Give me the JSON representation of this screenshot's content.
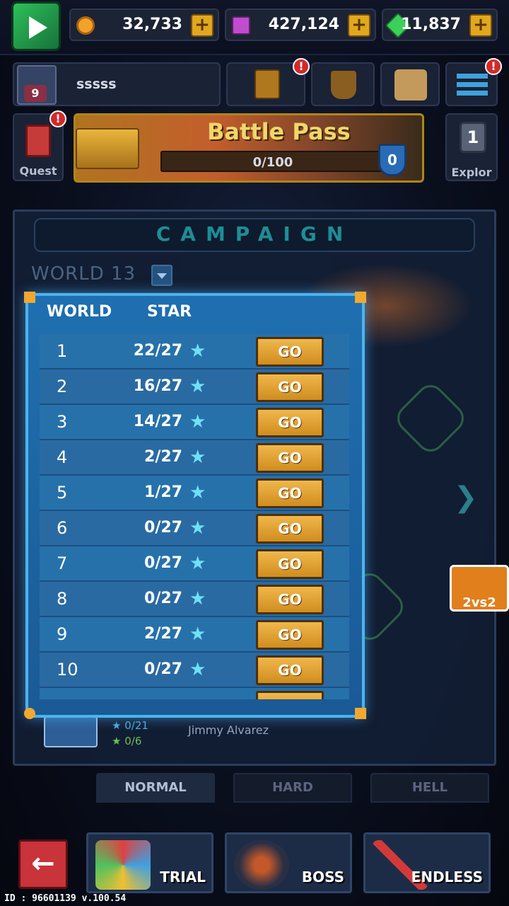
{
  "currencies": [
    {
      "name": "gold",
      "value": "32,733",
      "color": "#f0a22a"
    },
    {
      "name": "card",
      "value": "427,124",
      "color": "#c04cd0"
    },
    {
      "name": "gem",
      "value": "11,837",
      "color": "#3bd05a"
    }
  ],
  "player": {
    "name": "sssss",
    "level": "9"
  },
  "header_buttons": {
    "quest_label": "Quest",
    "explore_label": "Explor",
    "explore_level": "1"
  },
  "battle_pass": {
    "title": "Battle Pass",
    "progress": "0/100",
    "level": "0"
  },
  "campaign": {
    "title": "CAMPAIGN",
    "world_selector": "WORLD  13",
    "footer": {
      "stars_blue": "0/21",
      "stars_green": "0/6",
      "player_name": "Jimmy Alvarez"
    },
    "vs_badge": "2vs2"
  },
  "world_list": {
    "col_world": "WORLD",
    "col_star": "STAR",
    "go_label": "GO",
    "rows": [
      {
        "world": "1",
        "stars": "22/27"
      },
      {
        "world": "2",
        "stars": "16/27"
      },
      {
        "world": "3",
        "stars": "14/27"
      },
      {
        "world": "4",
        "stars": "2/27"
      },
      {
        "world": "5",
        "stars": "1/27"
      },
      {
        "world": "6",
        "stars": "0/27"
      },
      {
        "world": "7",
        "stars": "0/27"
      },
      {
        "world": "8",
        "stars": "0/27"
      },
      {
        "world": "9",
        "stars": "2/27"
      },
      {
        "world": "10",
        "stars": "0/27"
      }
    ]
  },
  "difficulty_tabs": [
    {
      "label": "NORMAL",
      "active": true
    },
    {
      "label": "HARD",
      "active": false
    },
    {
      "label": "HELL",
      "active": false
    }
  ],
  "modes": [
    {
      "label": "TRIAL"
    },
    {
      "label": "BOSS"
    },
    {
      "label": "ENDLESS"
    }
  ],
  "footer_id": "ID : 96601139 v.100.54"
}
